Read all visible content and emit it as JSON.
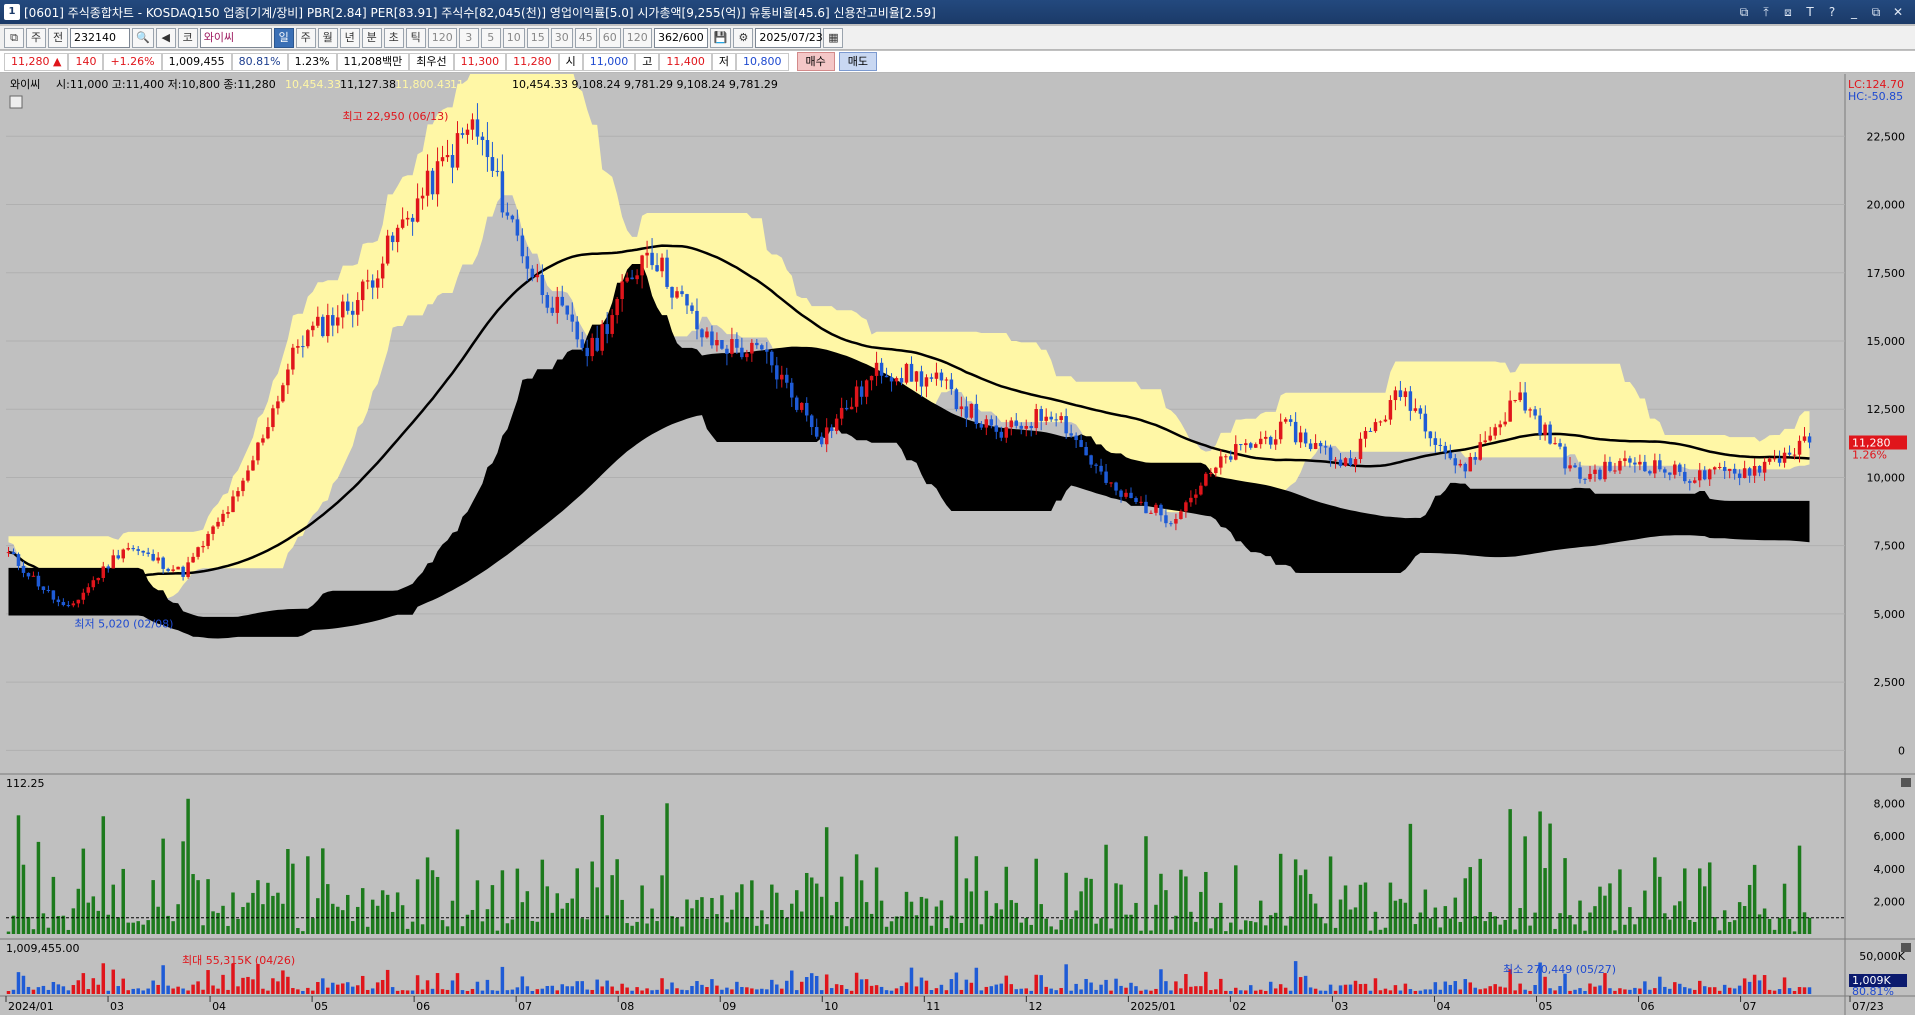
{
  "window": {
    "badge": "1",
    "title": "[0601] 주식종합차트 - KOSDAQ150 업종[기계/장비] PBR[2.84] PER[83.91] 주식수[82,045(천)] 영업이익률[5.0] 시가총액[9,255(억)] 유통비율[45.6] 신용잔고비율[2.59]",
    "controls": [
      "⧉",
      "⤒",
      "⧈",
      "T",
      "?",
      "_",
      "⧉",
      "✕"
    ]
  },
  "toolbar": {
    "menu_icon": "⧉",
    "market": "주",
    "full": "전",
    "code": "232140",
    "search_icon": "🔍",
    "speaker_icon": "◀",
    "market_tag": "코",
    "stock_name": "와이씨",
    "periods": [
      "일",
      "주",
      "월",
      "년",
      "분",
      "초",
      "틱"
    ],
    "active_period": "일",
    "intervals": [
      "120",
      "3",
      "5",
      "10",
      "15",
      "30",
      "45",
      "60",
      "120"
    ],
    "count": "362/600",
    "save_icon": "💾",
    "settings_icon": "⚙",
    "date": "2025/07/23",
    "calendar_icon": "▦"
  },
  "quote": {
    "price": "11,280",
    "arrow": "▲",
    "change": "140",
    "change_pct": "+1.26%",
    "volume": "1,009,455",
    "vol_ratio": "80.81%",
    "turnover": "1.23%",
    "amount": "11,208백만",
    "priority_seller": "최우선",
    "ask": "11,300",
    "bid": "11,280",
    "open_label": "시",
    "open": "11,000",
    "high_label": "고",
    "high": "11,400",
    "low_label": "저",
    "low": "10,800",
    "buy": "매수",
    "sell": "매도"
  },
  "legend": {
    "name": "와이씨",
    "ohlc": "시:11,000 고:11,400 저:10,800 종:11,280",
    "env_upper": "10,454.33",
    "env_mid": "11,127.38",
    "env_y1": "11,800.43",
    "env_y2": "11,127.38",
    "env_lines": "10,454.33 9,108.24 9,781.29 9,108.24 9,781.29",
    "lc": "LC:124.70",
    "hc": "HC:-50.85",
    "last_price": "11,280",
    "last_pct": "1.26%"
  },
  "annotations": {
    "high": "최고 22,950 (06/13)",
    "low": "최저 5,020 (02/08)",
    "vol_max": "최대 55,315K (04/26)",
    "vol_min": "최소 270,449 (05/27)"
  },
  "subpanels": {
    "indicator_value": "112.25",
    "volume_value": "1,009,455.00",
    "volume_last": "1,009K",
    "volume_pct": "80.81%"
  },
  "colors": {
    "up": "#e0151b",
    "down": "#1e5bd6",
    "envelope": "#fff7a6",
    "cloud": "#000000",
    "ma": "#000000",
    "bg": "#c0c0c0",
    "indicator": "#1d7a1d"
  },
  "chart_data": {
    "type": "candlestick",
    "price_axis": {
      "ticks": [
        0,
        2500,
        5000,
        7500,
        10000,
        12500,
        15000,
        17500,
        20000,
        22500
      ],
      "ylim": [
        -500,
        23500
      ]
    },
    "indicator_axis": {
      "ticks": [
        2000,
        4000,
        6000,
        8000
      ],
      "ylim": [
        0,
        8900
      ]
    },
    "volume_axis": {
      "ticks": [
        50000
      ],
      "tick_labels": [
        "50,000K"
      ]
    },
    "x_labels": [
      "2024/01",
      "03",
      "04",
      "05",
      "06",
      "07",
      "08",
      "09",
      "10",
      "11",
      "12",
      "2025/01",
      "02",
      "03",
      "04",
      "05",
      "06",
      "07",
      "07/23"
    ],
    "key_points": [
      {
        "month": "2024/01",
        "price": 7200
      },
      {
        "month": "2024/02",
        "price": 5100
      },
      {
        "month": "2024/03",
        "price": 7500
      },
      {
        "month": "2024/04",
        "price": 6500
      },
      {
        "month": "2024/04b",
        "price": 9500
      },
      {
        "month": "2024/05",
        "price": 15000
      },
      {
        "month": "2024/05b",
        "price": 16500
      },
      {
        "month": "2024/06",
        "price": 20000
      },
      {
        "month": "2024/06b",
        "price": 22950
      },
      {
        "month": "2024/07",
        "price": 17500
      },
      {
        "month": "2024/07b",
        "price": 14500
      },
      {
        "month": "2024/08",
        "price": 18500
      },
      {
        "month": "2024/08b",
        "price": 15000
      },
      {
        "month": "2024/09",
        "price": 14500
      },
      {
        "month": "2024/09b",
        "price": 11500
      },
      {
        "month": "2024/10",
        "price": 14000
      },
      {
        "month": "2024/10b",
        "price": 13500
      },
      {
        "month": "2024/11",
        "price": 11500
      },
      {
        "month": "2024/11b",
        "price": 12500
      },
      {
        "month": "2024/12",
        "price": 9500
      },
      {
        "month": "2024/12b",
        "price": 8500
      },
      {
        "month": "2025/01",
        "price": 10800
      },
      {
        "month": "2025/01b",
        "price": 11800
      },
      {
        "month": "2025/02",
        "price": 10500
      },
      {
        "month": "2025/02b",
        "price": 13200
      },
      {
        "month": "2025/03",
        "price": 10200
      },
      {
        "month": "2025/03b",
        "price": 13000
      },
      {
        "month": "2025/04",
        "price": 10000
      },
      {
        "month": "2025/05",
        "price": 10600
      },
      {
        "month": "2025/06",
        "price": 10000
      },
      {
        "month": "2025/07",
        "price": 10300
      },
      {
        "month": "2025/07b",
        "price": 11280
      }
    ]
  }
}
